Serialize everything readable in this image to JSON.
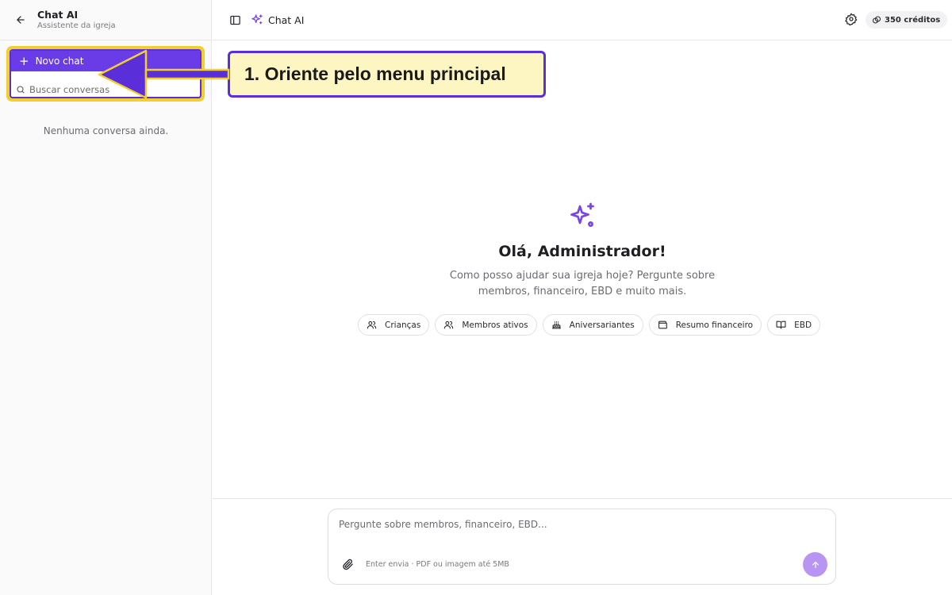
{
  "sidebar": {
    "title": "Chat AI",
    "subtitle": "Assistente da igreja",
    "new_chat_label": "Novo chat",
    "search_placeholder": "Buscar conversas",
    "empty_message": "Nenhuma conversa ainda."
  },
  "header": {
    "title": "Chat AI",
    "credits": "350 créditos"
  },
  "welcome": {
    "greeting": "Olá, Administrador!",
    "help_line1": "Como posso ajudar sua igreja hoje? Pergunte sobre",
    "help_line2": "membros, financeiro, EBD e muito mais."
  },
  "chips": [
    {
      "label": "Crianças",
      "icon": "users-icon"
    },
    {
      "label": "Membros ativos",
      "icon": "users-icon"
    },
    {
      "label": "Aniversariantes",
      "icon": "cake-icon"
    },
    {
      "label": "Resumo financeiro",
      "icon": "wallet-icon"
    },
    {
      "label": "EBD",
      "icon": "book-icon"
    }
  ],
  "composer": {
    "placeholder": "Pergunte sobre membros, financeiro, EBD...",
    "hint": "Enter envia · PDF ou imagem até 5MB"
  },
  "callout": {
    "text": "1. Oriente pelo menu principal"
  },
  "colors": {
    "accent": "#6a3ce8",
    "highlight": "#f2cf2e",
    "callout_bg": "#fdf6c3",
    "send_button": "#b895f2"
  }
}
